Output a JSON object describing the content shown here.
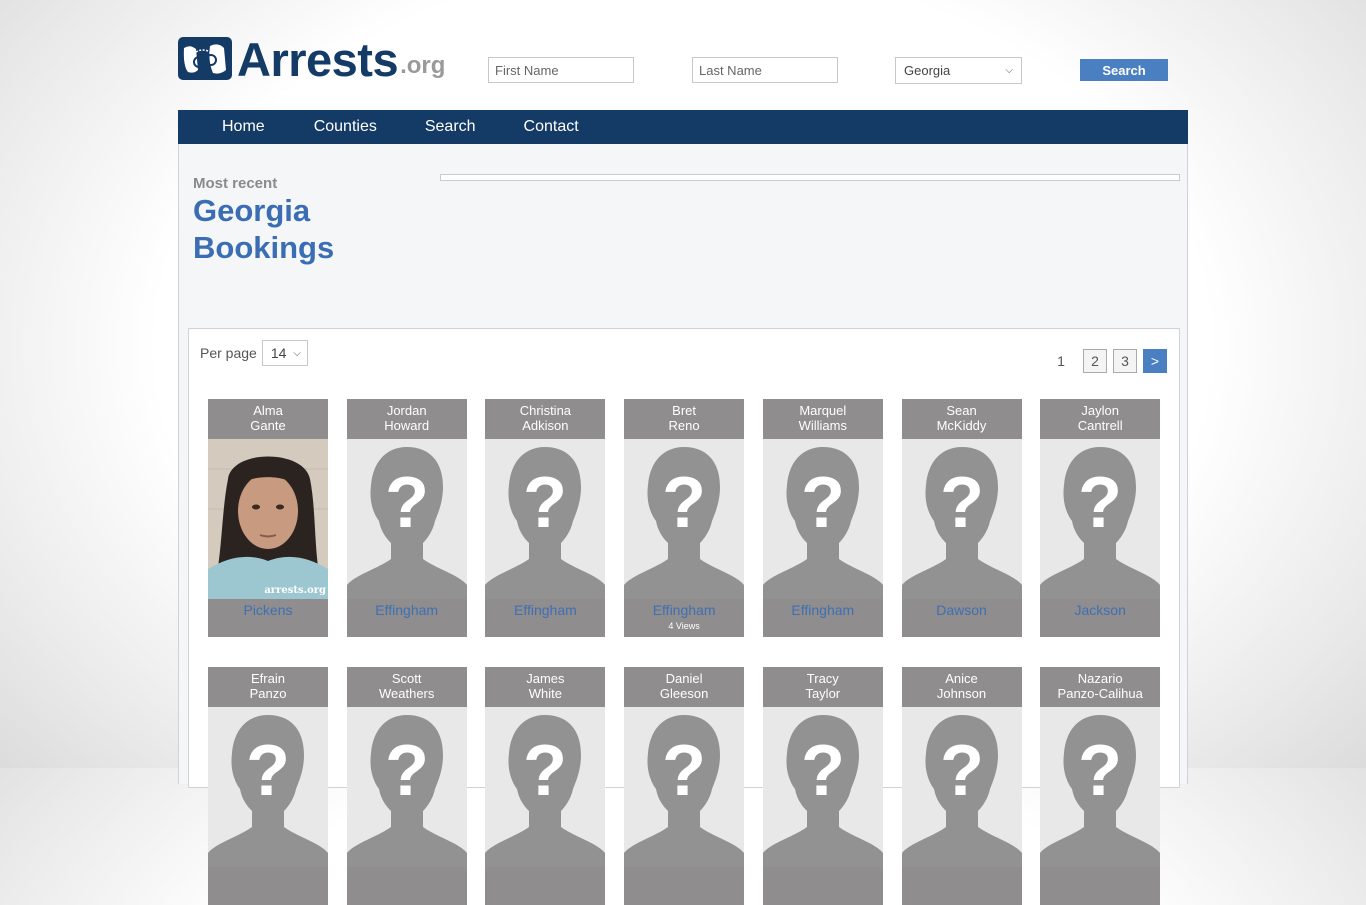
{
  "header": {
    "logo_text": "Arrests",
    "logo_suffix": ".org",
    "first_name_placeholder": "First Name",
    "last_name_placeholder": "Last Name",
    "state_selected": "Georgia",
    "search_label": "Search"
  },
  "nav": {
    "items": [
      {
        "label": "Home"
      },
      {
        "label": "Counties"
      },
      {
        "label": "Search"
      },
      {
        "label": "Contact"
      }
    ]
  },
  "main": {
    "kicker": "Most recent",
    "title_line1": "Georgia",
    "title_line2": "Bookings",
    "per_page_label": "Per page",
    "per_page_value": "14",
    "pagination": {
      "current": "1",
      "pages": [
        "2",
        "3"
      ],
      "next_label": ">"
    },
    "bookings": [
      {
        "first": "Alma",
        "last": "Gante",
        "county": "Pickens",
        "has_photo": true,
        "watermark": "arrests.org",
        "views": ""
      },
      {
        "first": "Jordan",
        "last": "Howard",
        "county": "Effingham",
        "has_photo": false,
        "views": ""
      },
      {
        "first": "Christina",
        "last": "Adkison",
        "county": "Effingham",
        "has_photo": false,
        "views": ""
      },
      {
        "first": "Bret",
        "last": "Reno",
        "county": "Effingham",
        "has_photo": false,
        "views": "4 Views"
      },
      {
        "first": "Marquel",
        "last": "Williams",
        "county": "Effingham",
        "has_photo": false,
        "views": ""
      },
      {
        "first": "Sean",
        "last": "McKiddy",
        "county": "Dawson",
        "has_photo": false,
        "views": ""
      },
      {
        "first": "Jaylon",
        "last": "Cantrell",
        "county": "Jackson",
        "has_photo": false,
        "views": ""
      },
      {
        "first": "Efrain",
        "last": "Panzo",
        "county": "",
        "has_photo": false,
        "views": ""
      },
      {
        "first": "Scott",
        "last": "Weathers",
        "county": "",
        "has_photo": false,
        "views": ""
      },
      {
        "first": "James",
        "last": "White",
        "county": "",
        "has_photo": false,
        "views": ""
      },
      {
        "first": "Daniel",
        "last": "Gleeson",
        "county": "",
        "has_photo": false,
        "views": ""
      },
      {
        "first": "Tracy",
        "last": "Taylor",
        "county": "",
        "has_photo": false,
        "views": ""
      },
      {
        "first": "Anice",
        "last": "Johnson",
        "county": "",
        "has_photo": false,
        "views": ""
      },
      {
        "first": "Nazario",
        "last": "Panzo-Calihua",
        "county": "",
        "has_photo": false,
        "views": ""
      }
    ]
  },
  "colors": {
    "brand_navy": "#143a66",
    "accent_blue": "#4a7fc1",
    "title_blue": "#3a6db3",
    "card_gray": "#8f8d8e"
  }
}
